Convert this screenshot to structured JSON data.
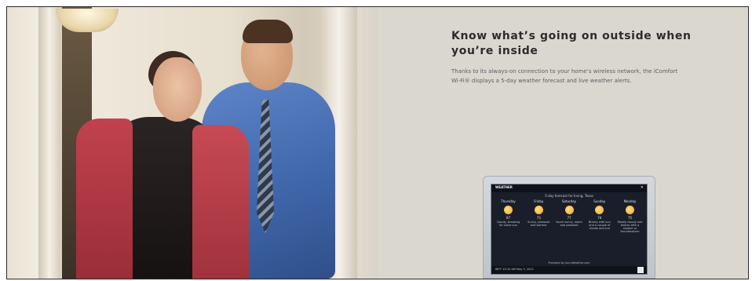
{
  "hero": {
    "headline": "Know what’s going on outside when you’re inside",
    "body": "Thanks to its always-on connection to your home’s wireless network, the iComfort Wi-Fi® displays a 5-day weather forecast and live weather alerts."
  },
  "device": {
    "title": "WEATHER",
    "close": "✕",
    "forecast_title": "5-day forecast for Irving, Texas",
    "days": [
      {
        "day": "Thursday",
        "temp": "67",
        "desc": "Cloudy, breaking for some sun"
      },
      {
        "day": "Friday",
        "temp": "73",
        "desc": "Sunny, pleasant and warmer"
      },
      {
        "day": "Saturday",
        "temp": "77",
        "desc": "Some sunny, warm and pleasant"
      },
      {
        "day": "Sunday",
        "temp": "74",
        "desc": "Breezy with sun and a couple of clouds and sun"
      },
      {
        "day": "Monday",
        "temp": "75",
        "desc": "Mostly cloudy and breezy with a shower or thunderstorm"
      }
    ],
    "credit": "Provided by AccuWeather.com",
    "status": "68°F  10:10 AM    May 3, 2012"
  },
  "colors": {
    "content_bg": "#dad7cf",
    "headline": "#2c2c2c",
    "body": "#5e5e5e",
    "screen_bg": "#1a1e2a"
  }
}
